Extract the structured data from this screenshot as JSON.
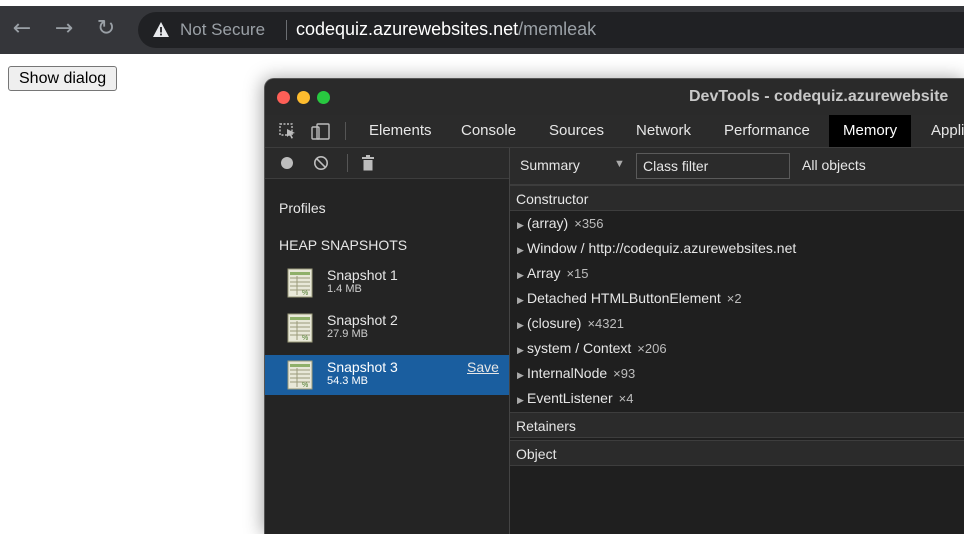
{
  "browser": {
    "security_label": "Not Secure",
    "url_host": "codequiz.azurewebsites.net",
    "url_path": "/memleak"
  },
  "page": {
    "show_dialog_label": "Show dialog"
  },
  "devtools": {
    "window_title": "DevTools - codequiz.azurewebsite",
    "tabs": [
      "Elements",
      "Console",
      "Sources",
      "Network",
      "Performance",
      "Memory",
      "Appli"
    ],
    "active_tab": "Memory",
    "sidebar": {
      "profiles_label": "Profiles",
      "heap_snapshots_label": "HEAP SNAPSHOTS",
      "snapshots": [
        {
          "name": "Snapshot 1",
          "size": "1.4 MB"
        },
        {
          "name": "Snapshot 2",
          "size": "27.9 MB"
        },
        {
          "name": "Snapshot 3",
          "size": "54.3 MB",
          "action": "Save"
        }
      ]
    },
    "toolbar": {
      "view_label": "Summary",
      "class_filter_placeholder": "Class filter",
      "objects_label": "All objects"
    },
    "constructor_header": "Constructor",
    "rows": [
      {
        "name": "(array)",
        "count": "×356"
      },
      {
        "name": "Window / http://codequiz.azurewebsites.net",
        "count": ""
      },
      {
        "name": "Array",
        "count": "×15"
      },
      {
        "name": "Detached HTMLButtonElement",
        "count": "×2"
      },
      {
        "name": "(closure)",
        "count": "×4321"
      },
      {
        "name": "system / Context",
        "count": "×206"
      },
      {
        "name": "InternalNode",
        "count": "×93"
      },
      {
        "name": "EventListener",
        "count": "×4"
      }
    ],
    "retainers_header": "Retainers",
    "object_header": "Object"
  },
  "colors": {
    "selected_row": "#1a5e9f",
    "active_tab_bg": "#000000",
    "close_light": "#fe5f57",
    "minimize_light": "#febc2e",
    "zoom_light": "#28c840"
  }
}
